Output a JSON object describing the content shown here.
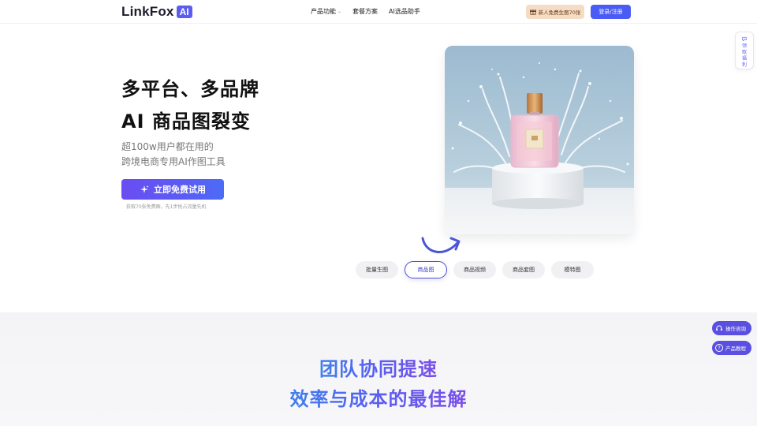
{
  "header": {
    "logo_text": "LinkFox",
    "logo_badge": "AI",
    "nav": [
      {
        "label": "产品功能",
        "has_dropdown": true
      },
      {
        "label": "套餐方案",
        "has_dropdown": false
      },
      {
        "label": "AI选品助手",
        "has_dropdown": false
      }
    ],
    "promo_label": "新人免费生图70张",
    "login_label": "登录/注册"
  },
  "side": {
    "welfare_label": "领取福利"
  },
  "hero": {
    "title_line1": "多平台、多品牌",
    "title_line2": "AI 商品图裂变",
    "sub_line1": "超100w用户都在用的",
    "sub_line2": "跨境电商专用AI作图工具",
    "cta_label": "立即免费试用",
    "cta_note": "获取70张免费图，先1步抢占流量先机"
  },
  "tabs": [
    {
      "label": "批量生图",
      "active": false
    },
    {
      "label": "商品图",
      "active": true
    },
    {
      "label": "商品视频",
      "active": false
    },
    {
      "label": "商品套图",
      "active": false
    },
    {
      "label": "模特图",
      "active": false
    }
  ],
  "floating": {
    "consult_label": "操作咨询",
    "tutorial_label": "产品教程"
  },
  "section2": {
    "line1": "团队协同提速",
    "line2": "效率与成本的最佳解"
  },
  "colors": {
    "brand": "#5b5cf0",
    "login_button": "#4b5bf5",
    "promo_button": "#f5dcc4",
    "floating_button": "#5a4fe0"
  },
  "icons": {
    "promo": "gift-icon",
    "cta": "sparkle-icon",
    "welfare": "chat-icon",
    "consult": "headset-icon",
    "tutorial": "help-icon",
    "arrow": "curved-arrow-icon"
  }
}
